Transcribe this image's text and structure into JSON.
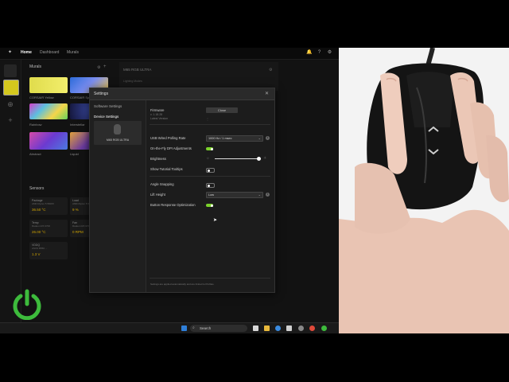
{
  "app": {
    "tabs": [
      {
        "label": "Home",
        "active": true
      },
      {
        "label": "Dashboard",
        "active": false
      },
      {
        "label": "Murals",
        "active": false
      }
    ],
    "top_icons": [
      "bell-icon",
      "help-icon",
      "settings-icon"
    ]
  },
  "home": {
    "murals_title": "Murals",
    "murals": [
      {
        "label": "CORSAIR Yellow",
        "color": "#e8e25a"
      },
      {
        "label": "CORSAIR Sp...",
        "color": "#3a5fd9"
      },
      {
        "label": "Rainbow",
        "color": "#b05ad6"
      },
      {
        "label": "Interstellar",
        "color": "#2a2f6a"
      },
      {
        "label": "Abstract",
        "color": "#6a3cc0"
      },
      {
        "label": "Liquid",
        "color": "#5b3f9a"
      }
    ],
    "device_title": "M65 RGB ULTRA",
    "device_sub": "Lighting Modes",
    "sensors_title": "Sensors",
    "sensors": [
      {
        "name": "Package",
        "sub": "AMD Ryzen 5 5600X",
        "value": "36.50 °C"
      },
      {
        "name": "Load",
        "sub": "AMD Ryzen 5 5600X",
        "value": "9 %"
      },
      {
        "name": "Temp",
        "sub": "Radeon RX 6700",
        "value": "26.00 °C"
      },
      {
        "name": "Fan",
        "sub": "Radeon RX 6700",
        "value": "0 RPM"
      },
      {
        "name": "VDDQ",
        "sub": "ASUS B550 ...",
        "value": "1.3 V"
      }
    ]
  },
  "settings": {
    "title": "Settings",
    "nav": {
      "software": "Software Settings",
      "device": "Device Settings",
      "device_name": "M65 RGB ULTRA"
    },
    "firmware": {
      "label": "Firmware",
      "version": "v. 1.18.28",
      "latest": "Latest Version",
      "button": "Close"
    },
    "polling": {
      "label": "USB Wired Polling Rate",
      "value": "1000 Hz / 1 msec"
    },
    "otf_dpi": {
      "label": "On-the-Fly DPI Adjustments",
      "on": true
    },
    "brightness": {
      "label": "Brightness",
      "level": 0.95
    },
    "tooltips": {
      "label": "Show Tutorial Tooltips",
      "on": false
    },
    "angle_snapping": {
      "label": "Angle Snapping",
      "on": false
    },
    "lift_height": {
      "label": "Lift Height",
      "value": "Low"
    },
    "button_opt": {
      "label": "Button Response Optimization",
      "on": true
    },
    "footer": "Settings are applied automatically and are limited to Profiles."
  },
  "taskbar": {
    "search_label": "Search"
  },
  "colors": {
    "accent_green": "#7bd22b",
    "power_green": "#3dbb3c"
  }
}
